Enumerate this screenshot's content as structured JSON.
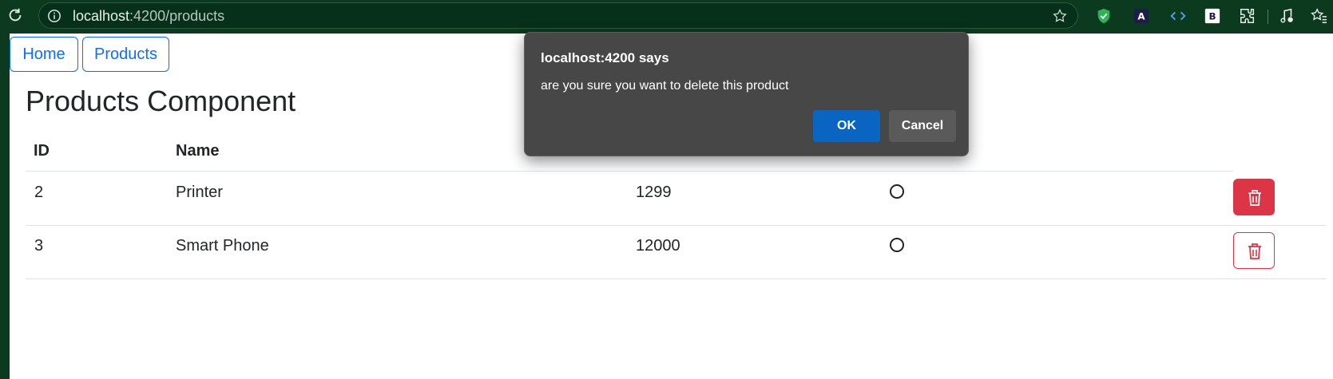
{
  "browser": {
    "url_host": "localhost",
    "url_rest": ":4200/products",
    "colors": {
      "chrome_bg": "#0b3a1e",
      "urlbar_bg": "#07301a"
    },
    "icons": [
      "reload-icon",
      "site-info-icon",
      "bookmark-star-icon",
      "shield-extension-icon",
      "translate-extension-icon",
      "code-extension-icon",
      "bootstrap-extension-icon",
      "extensions-puzzle-icon",
      "media-control-icon",
      "favorites-icon"
    ]
  },
  "nav": {
    "home_label": "Home",
    "products_label": "Products"
  },
  "page": {
    "title": "Products Component"
  },
  "table": {
    "headers": [
      "ID",
      "Name"
    ],
    "rows": [
      {
        "id": "2",
        "name": "Printer",
        "price": "1299"
      },
      {
        "id": "3",
        "name": "Smart Phone",
        "price": "12000"
      }
    ]
  },
  "dialog": {
    "title": "localhost:4200 says",
    "message": "are you sure you want to delete this product",
    "ok_label": "OK",
    "cancel_label": "Cancel",
    "colors": {
      "bg": "#474747",
      "ok": "#0a64c2",
      "cancel": "#5a5a5a"
    }
  },
  "colors": {
    "primary": "#0d6efd",
    "danger": "#dc3545"
  }
}
